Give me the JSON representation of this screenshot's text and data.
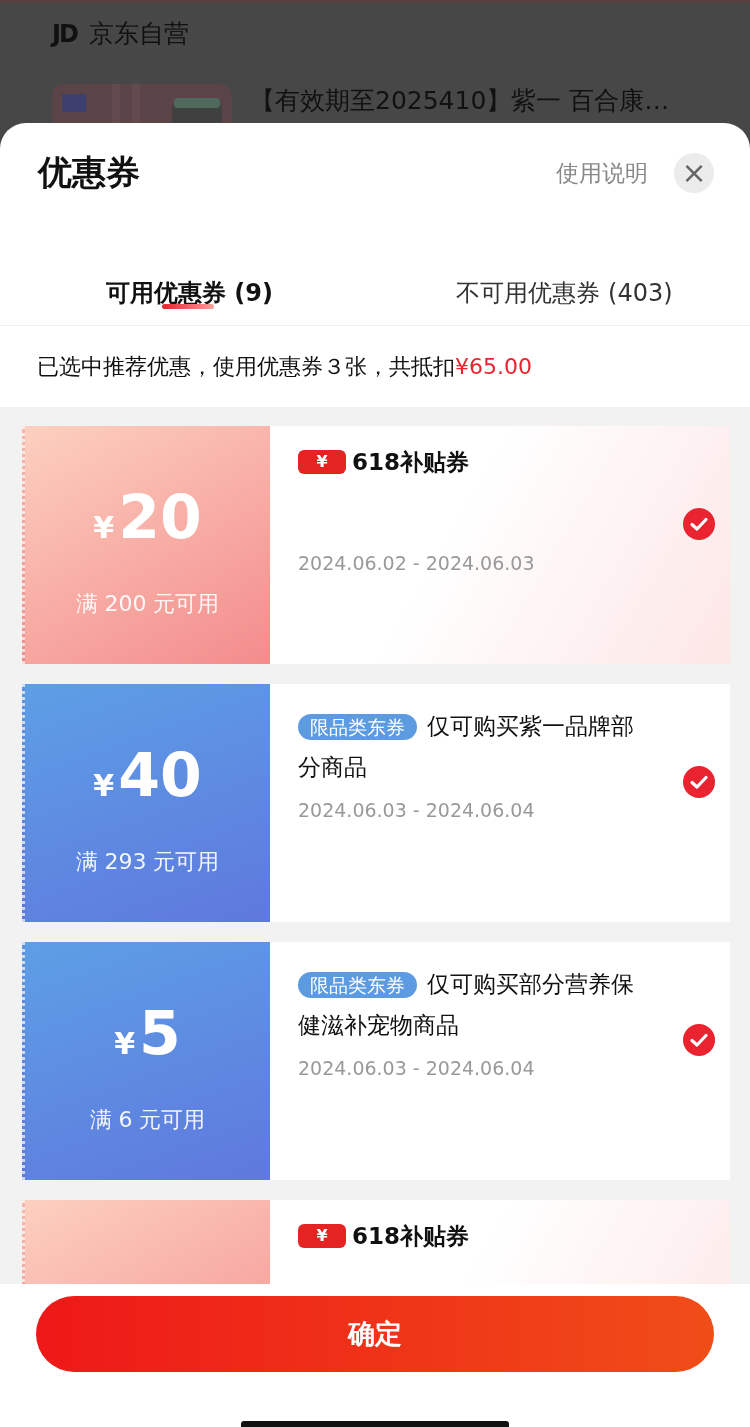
{
  "background": {
    "store_logo": "JD",
    "store_name": "京东自营",
    "product_title": "【有效期至2025410】紫一 百合康…"
  },
  "sheet": {
    "title": "优惠券",
    "help_link": "使用说明",
    "close": "×"
  },
  "tabs": [
    {
      "label": "可用优惠券 (9)",
      "selected": true
    },
    {
      "label": "不可用优惠券 (403)",
      "selected": false
    }
  ],
  "summary": {
    "text": "已选中推荐优惠，使用优惠券３张，共抵扣",
    "amount": "¥65.00"
  },
  "coupons": [
    {
      "kind": "subsidy",
      "currency": "¥",
      "amount": "20",
      "condition": "满 200 元可用",
      "badge_symbol": "¥",
      "badge_text": "618补贴券",
      "dates": "2024.06.02 - 2024.06.03",
      "checked": true
    },
    {
      "kind": "category",
      "currency": "¥",
      "amount": "40",
      "condition": "满 293 元可用",
      "tag": "限品类东券",
      "description": "仅可购买紫一品牌部分商品",
      "dates": "2024.06.03 - 2024.06.04",
      "checked": true
    },
    {
      "kind": "category",
      "currency": "¥",
      "amount": "5",
      "condition": "满 6 元可用",
      "tag": "限品类东券",
      "description": "仅可购买部分营养保健滋补宠物商品",
      "dates": "2024.06.03 - 2024.06.04",
      "checked": true
    },
    {
      "kind": "subsidy",
      "badge_symbol": "¥",
      "badge_text": "618补贴券"
    }
  ],
  "confirm_button": "确定"
}
